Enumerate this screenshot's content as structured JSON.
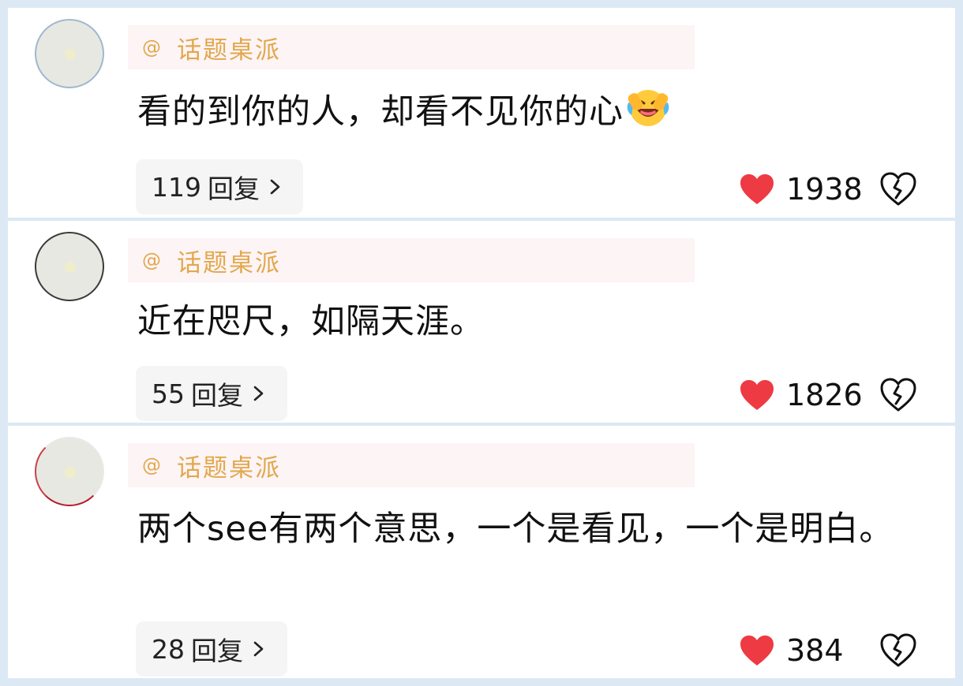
{
  "comments": [
    {
      "author": "话题桌派",
      "at_symbol": "@",
      "text": "看的到你的人，却看不见你的心",
      "has_emoji": true,
      "emoji_name": "laughing-crying-emoji",
      "reply_count": "119",
      "reply_label": "回复",
      "like_count": "1938"
    },
    {
      "author": "话题桌派",
      "at_symbol": "@",
      "text": "近在咫尺，如隔天涯。",
      "has_emoji": false,
      "reply_count": "55",
      "reply_label": "回复",
      "like_count": "1826"
    },
    {
      "author": "话题桌派",
      "at_symbol": "@",
      "text": "两个see有两个意思，一个是看见，一个是明白。",
      "has_emoji": false,
      "reply_count": "28",
      "reply_label": "回复",
      "like_count": "384"
    }
  ],
  "icons": {
    "like": "heart-icon",
    "dislike": "broken-heart-icon",
    "chevron": "chevron-right-icon"
  },
  "colors": {
    "background": "#dce9f4",
    "card": "#ffffff",
    "author": "#e2a84b",
    "author_bar": "#fdf4f6",
    "heart": "#ee3a43",
    "reply_bg": "#f5f5f5"
  }
}
